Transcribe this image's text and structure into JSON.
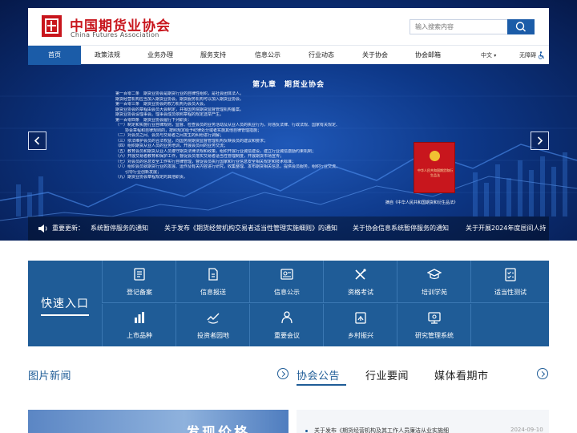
{
  "header": {
    "logo_cn": "中国期货业协会",
    "logo_en": "China Futures  Association",
    "search_placeholder": "输入搜索内容"
  },
  "nav": {
    "items": [
      "首页",
      "政策法规",
      "业务办理",
      "服务支持",
      "信息公示",
      "行业动态",
      "关于协会",
      "协会邮箱"
    ],
    "active_index": 0,
    "language": "中文",
    "accessibility": "无障碍"
  },
  "slide": {
    "title": "第九章　期货业协会",
    "lines": [
      "第一百零二条　期货业协会是期货行业的自律性组织，是社会团体法人。",
      "期货经营机构应当加入期货业协会。期货服务机构可以加入期货业协会。",
      "第一百零三条　期货业协会的权力机构为会员大会。",
      "期货业协会的章程由会员大会制定，并报国务院期货监督管理机构备案。",
      "期货业协会设理事会。理事会成员依照章程的规定选举产生。",
      "第一百零四条　期货业协会履行下列职责：",
      "（一）制定和实施行业自律规则，监督、检查会员的业务活动及从业人员的执业行为，对违反法律、行政法规、国家有关规定、",
      "协会章程和自律规则的，按照规定给予纪律处分或者实施其他自律管理措施；",
      "（二）对会员之间、会员与交易者之间发生的纠纷进行调解；",
      "（三）依法维护会员的合法权益，向国务院期货监督管理机构反映会员的建议和要求；",
      "（四）组织期货从业人员的业务培训，开展会员间的业务交流；",
      "（五）教育会员和期货从业人员遵守期货法律法规和政策，组织开展行业诚信建设，建立行业诚信激励约束机制；",
      "（六）开展交易者教育和保护工作，督促会员落实交易者适当性管理制度，开展期货市场宣传；",
      "（七）对会员的信息安全工作实行自律管理，督促会员执行国家和行业信息安全相关规定和技术标准；",
      "（八）组织会员就期货行业的发展、运作及有关内容进行研究，收集整理、发布期货相关信息，提供会员服务，组织行业交流，",
      "引导行业创新发展；",
      "（九）期货业协会章程规定的其他职责。"
    ],
    "book_text": "中华人民共和国期货和衍生品法",
    "caption": "摘自《中华人民共和国期货和衍生品法》"
  },
  "ticker": {
    "label": "重要更新：",
    "items": [
      "系统暂停服务的通知",
      "关于发布《期货经营机构交易者适当性管理实施细则》的通知",
      "关于协会信息系统暂停服务的通知",
      "关于开展2024年度居间人持"
    ]
  },
  "quick": {
    "title": "快速入口",
    "items": [
      {
        "label": "登记备案",
        "icon": "register-icon"
      },
      {
        "label": "信息报送",
        "icon": "report-icon"
      },
      {
        "label": "信息公示",
        "icon": "info-publish-icon"
      },
      {
        "label": "资格考试",
        "icon": "exam-icon"
      },
      {
        "label": "培训学苑",
        "icon": "training-icon"
      },
      {
        "label": "适当性测试",
        "icon": "checklist-icon"
      },
      {
        "label": "上市品种",
        "icon": "bar-chart-icon"
      },
      {
        "label": "投资者园地",
        "icon": "investor-icon"
      },
      {
        "label": "重要会议",
        "icon": "meeting-icon"
      },
      {
        "label": "乡村振兴",
        "icon": "village-icon"
      },
      {
        "label": "研究管理系统",
        "icon": "monitor-icon"
      }
    ]
  },
  "sections": {
    "photo_news": "图片新闻",
    "tabs": [
      "协会公告",
      "行业要闻",
      "媒体看期市"
    ]
  },
  "photo_news_banner": "发现价格",
  "notice": {
    "text": "关于发布《期货经营机构及其工作人员廉洁从业实施细",
    "date": "2024-09-10"
  },
  "colors": {
    "brand_red": "#c8161d",
    "brand_blue": "#1b5ca8",
    "quick_bg": "#1f5c97"
  }
}
